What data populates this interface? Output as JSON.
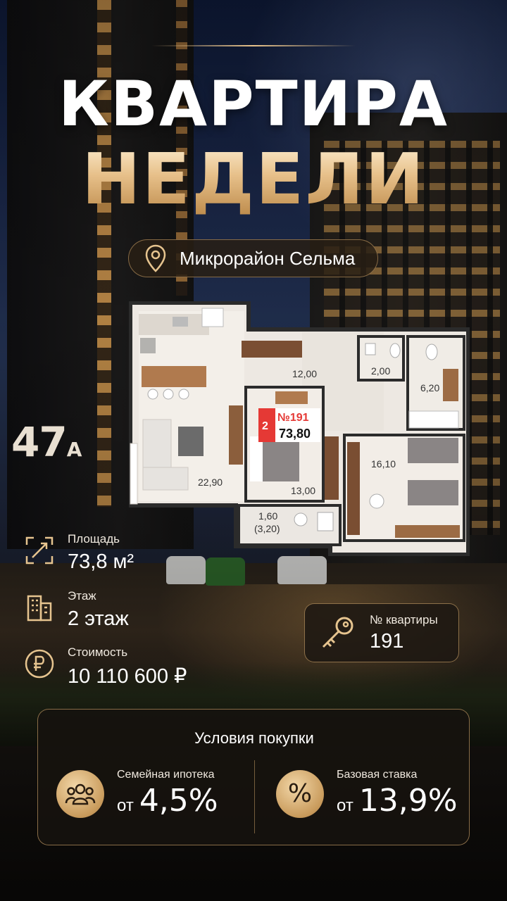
{
  "header": {
    "title_line1": "КВАРТИРА",
    "title_line2": "НЕДЕЛИ"
  },
  "location": {
    "icon": "map-pin-icon",
    "label": "Микрорайон Сельма"
  },
  "building_number": {
    "main": "47",
    "suffix": "А"
  },
  "floor_plan": {
    "tag_floor": "2",
    "tag_number": "№191",
    "tag_area": "73,80",
    "rooms": [
      "12,00",
      "2,00",
      "6,20",
      "22,90",
      "13,00",
      "16,10",
      "1,60",
      "(3,20)"
    ]
  },
  "specs": [
    {
      "icon": "area-arrows-icon",
      "label": "Площадь",
      "value": "73,8 м²"
    },
    {
      "icon": "building-icon",
      "label": "Этаж",
      "value": "2 этаж"
    },
    {
      "icon": "ruble-coin-icon",
      "label": "Стоимость",
      "value": "10 110 600 ₽"
    }
  ],
  "apartment": {
    "icon": "key-icon",
    "label": "№ квартиры",
    "value": "191"
  },
  "conditions": {
    "title": "Условия покупки",
    "items": [
      {
        "icon": "family-icon",
        "label": "Семейная ипотека",
        "prefix": "от",
        "value": "4,5%"
      },
      {
        "icon": "percent-icon",
        "symbol": "%",
        "label": "Базовая ставка",
        "prefix": "от",
        "value": "13,9%"
      }
    ]
  },
  "colors": {
    "gold": "#d6aa6e",
    "gold_light": "#f2d7a8",
    "panel": "#1e1812",
    "tag_red": "#e53935"
  }
}
